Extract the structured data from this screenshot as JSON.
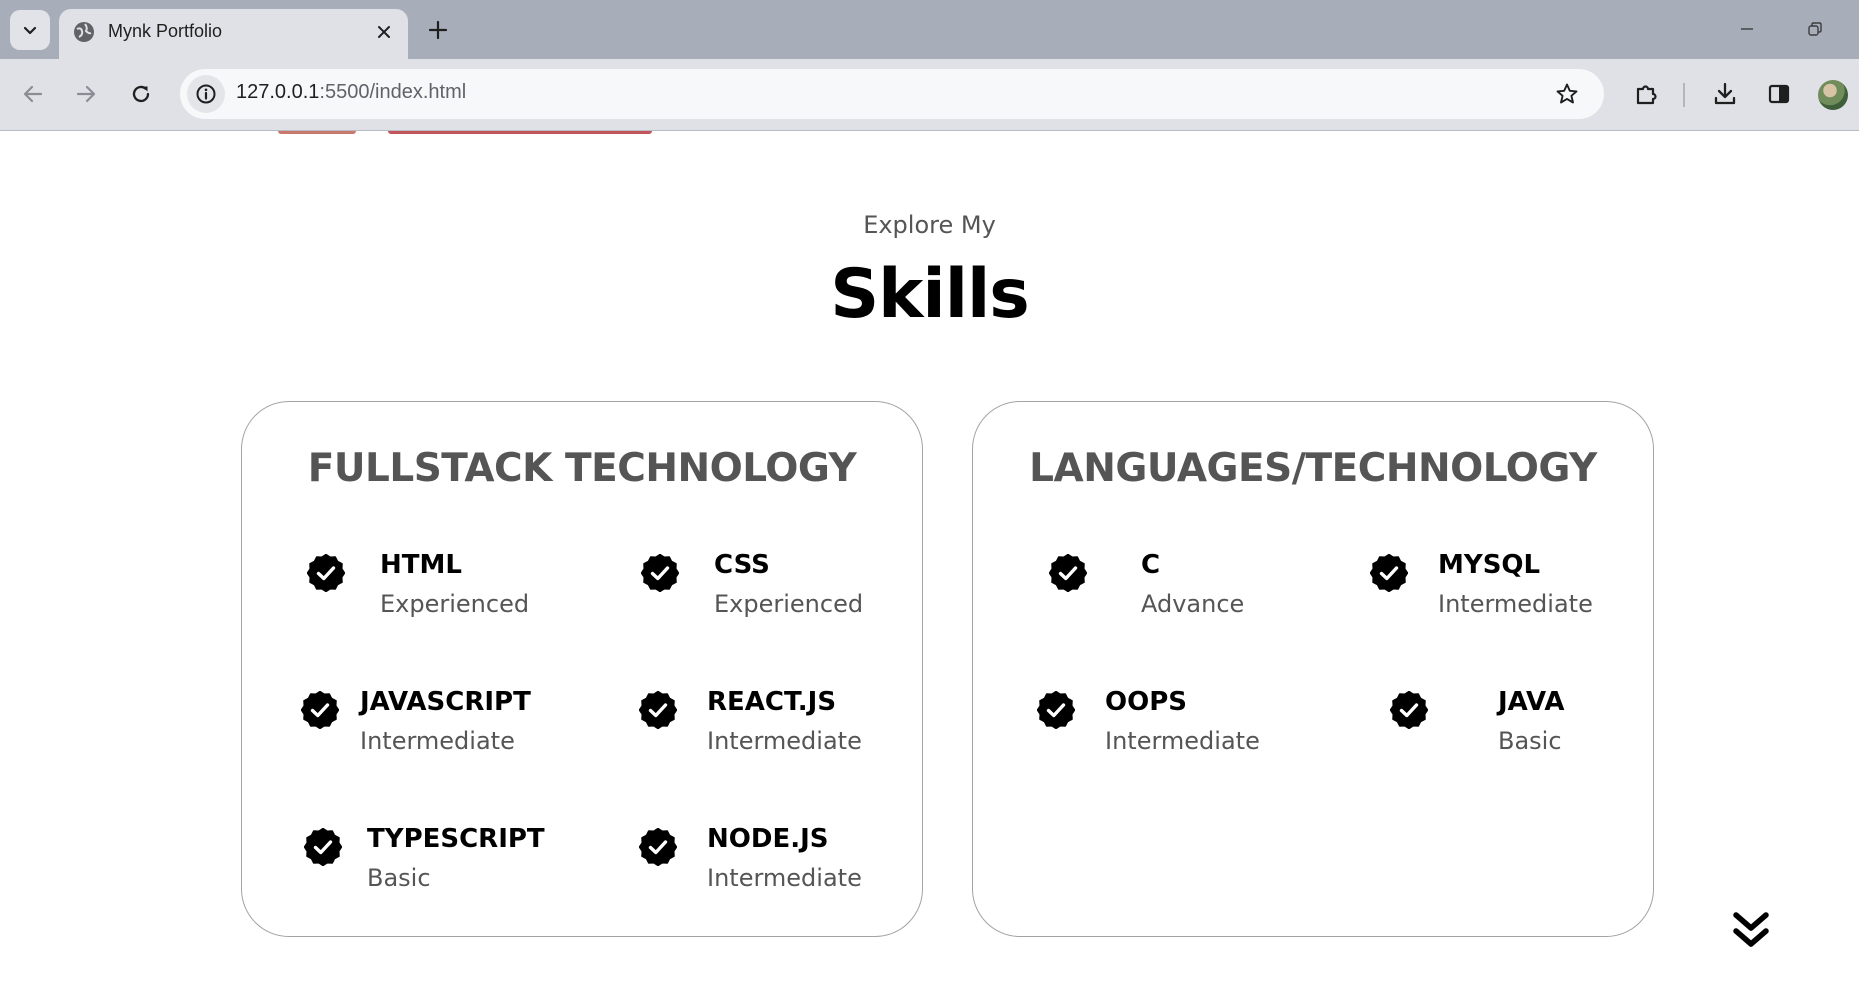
{
  "browser": {
    "tab_title": "Mynk Portfolio",
    "url_host": "127.0.0.1",
    "url_path": ":5500/index.html"
  },
  "section": {
    "subtitle": "Explore My",
    "title": "Skills"
  },
  "cards": [
    {
      "title": "FULLSTACK TECHNOLOGY",
      "skills": [
        {
          "name": "HTML",
          "level": "Experienced"
        },
        {
          "name": "CSS",
          "level": "Experienced"
        },
        {
          "name": "JAVASCRIPT",
          "level": "Intermediate"
        },
        {
          "name": "REACT.JS",
          "level": "Intermediate"
        },
        {
          "name": "TYPESCRIPT",
          "level": "Basic"
        },
        {
          "name": "NODE.JS",
          "level": "Intermediate"
        }
      ]
    },
    {
      "title": "LANGUAGES/TECHNOLOGY",
      "skills": [
        {
          "name": "C",
          "level": "Advance"
        },
        {
          "name": "MYSQL",
          "level": "Intermediate"
        },
        {
          "name": "OOPS",
          "level": "Intermediate"
        },
        {
          "name": "JAVA",
          "level": "Basic"
        }
      ]
    }
  ],
  "icons": {
    "skill_check": "checkmark-badge-icon",
    "scroll": "double-chevron-down-icon"
  }
}
